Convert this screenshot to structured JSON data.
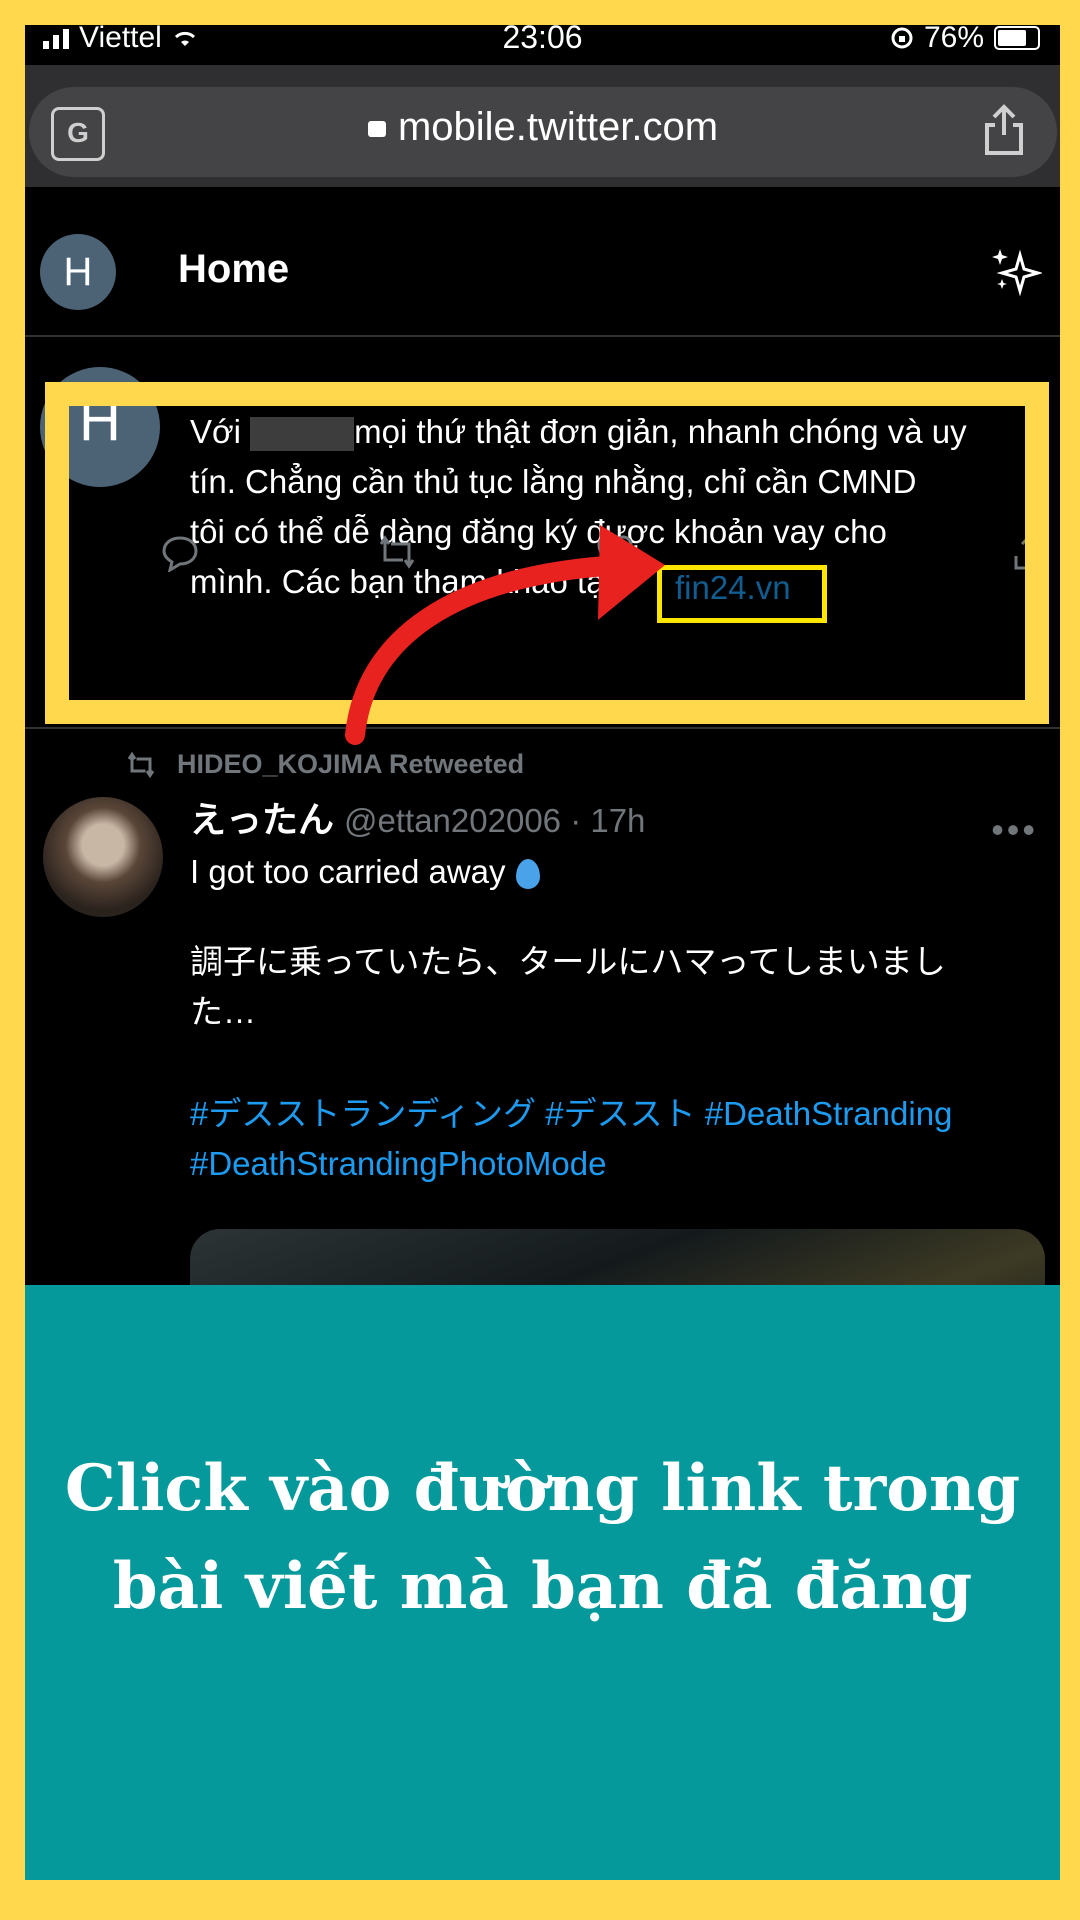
{
  "status_bar": {
    "carrier": "Viettel",
    "time": "23:06",
    "battery": "76%"
  },
  "browser": {
    "url": "mobile.twitter.com",
    "translate_icon": "translate-icon",
    "share_icon": "share-icon"
  },
  "header": {
    "avatar_initial": "H",
    "title": "Home",
    "sparkle_icon": "sparkle-icon"
  },
  "tweet1": {
    "avatar_initial": "H",
    "text_line1_a": "Với",
    "text_line1_b": "mọi thứ thật đơn giản, nhanh chóng và uy",
    "text_rest": "tín. Chẳng cần thủ tục lằng nhằng, chỉ cần CMND\ntôi có thể dễ dàng đăng ký được khoản vay cho\nmình. Các bạn tham khảo tại",
    "link": "fin24.vn"
  },
  "tweet2": {
    "retweet_label": "HIDEO_KOJIMA Retweeted",
    "name": "えったん",
    "handle": "@ettan202006 · 17h",
    "more": "•••",
    "text_en": "I got too carried away",
    "text_jp": "調子に乗っていたら、タールにハマってしまいました…",
    "hashtags": "#デスストランディング #デススト #DeathStranding #DeathStrandingPhotoMode"
  },
  "caption": {
    "text": "Click vào đường link trong bài viết mà bạn đã đăng"
  },
  "colors": {
    "frame": "#ffd84d",
    "teal": "#06999c",
    "twitter_blue": "#1d9bf0",
    "arrow": "#e8231f"
  }
}
